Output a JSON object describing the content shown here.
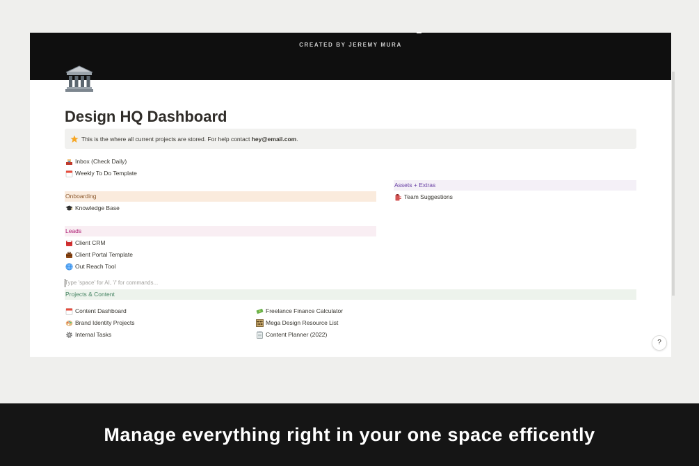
{
  "page": {
    "cover_text": "CREATED BY JEREMY MURA",
    "icon": "classical-building-icon",
    "title": "Design HQ Dashboard"
  },
  "callout": {
    "icon": "star-icon",
    "text": "This is the where all current projects are stored. For help contact ",
    "email": "hey@email.com",
    "suffix": "."
  },
  "quick_links": [
    {
      "label": "Inbox (Check Daily)",
      "icon": "inbox-tray-icon"
    },
    {
      "label": "Weekly To Do Template",
      "icon": "calendar-icon"
    }
  ],
  "sections": {
    "onboarding": {
      "title": "Onboarding",
      "color": "#faebdd",
      "text_color": "#8c5a2f",
      "items": [
        {
          "label": "Knowledge Base",
          "icon": "graduation-cap-icon"
        }
      ]
    },
    "leads": {
      "title": "Leads",
      "color": "#f9eef3",
      "text_color": "#ad1a72",
      "items": [
        {
          "label": "Client CRM",
          "icon": "card-index-box-icon"
        },
        {
          "label": "Client Portal Template",
          "icon": "briefcase-icon"
        },
        {
          "label": "Out Reach Tool",
          "icon": "globe-icon"
        }
      ]
    },
    "assets": {
      "title": "Assets + Extras",
      "color": "#f4f0f7",
      "text_color": "#6940a5",
      "items": [
        {
          "label": "Team Suggestions",
          "icon": "clipboard-icon"
        }
      ]
    },
    "projects": {
      "title": "Projects & Content",
      "color": "#edf3ec",
      "text_color": "#448361",
      "items_left": [
        {
          "label": "Content Dashboard",
          "icon": "calendar-icon"
        },
        {
          "label": "Brand Identity Projects",
          "icon": "palette-icon"
        },
        {
          "label": "Internal Tasks",
          "icon": "gear-icon"
        }
      ],
      "items_right": [
        {
          "label": "Freelance Finance Calculator",
          "icon": "money-icon"
        },
        {
          "label": "Mega Design Resource List",
          "icon": "abacus-icon"
        },
        {
          "label": "Content Planner (2022)",
          "icon": "spiral-notepad-icon"
        }
      ]
    }
  },
  "editor": {
    "placeholder": "Type 'space' for AI, '/' for commands..."
  },
  "help_button": "?",
  "footer": {
    "tagline": "Manage everything right in your one space efficently"
  }
}
